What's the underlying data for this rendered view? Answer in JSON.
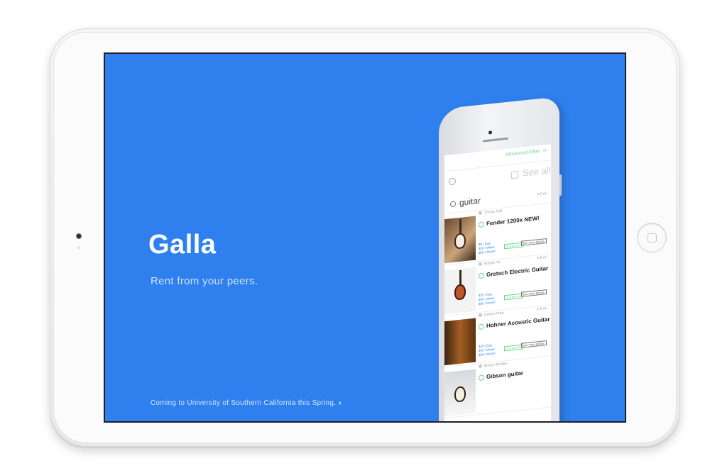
{
  "app": {
    "name": "Galla",
    "tagline": "Rent from your peers.",
    "coming_soon": "Coming to University of Southern California this Spring.",
    "coming_soon_chevron": "›"
  },
  "phone_app": {
    "advanced_filter": "Advanced Filter",
    "see_all": "See all",
    "search_query": "guitar",
    "search_distance": "0.2 mi",
    "listings": [
      {
        "owner": "Trevan Hall",
        "distance": "",
        "title": "Fender 1200x NEW!",
        "prices": [
          "$8 / Day",
          "$20 / Week",
          "$50 / Month"
        ],
        "rent_label": "rent by item",
        "more_label": "see more photos"
      },
      {
        "owner": "Bobbie Yu",
        "distance": "5.8 mi",
        "title": "Gretsch Electric Guitar",
        "prices": [
          "$25 / Day",
          "$40 / Week",
          "$90 / Month"
        ],
        "rent_label": "rent by item",
        "more_label": "see more photos"
      },
      {
        "owner": "Darius Feng",
        "distance": "5.8 mi",
        "title": "Hohner Acoustic Guitar",
        "prices": [
          "$25 / Day",
          "$40 / Week",
          "$58 / Month"
        ],
        "rent_label": "rent by item",
        "more_label": "see more photos"
      },
      {
        "owner": "Britton Bentley",
        "distance": "",
        "title": "Gibson guitar",
        "prices": [],
        "rent_label": "",
        "more_label": ""
      }
    ]
  },
  "colors": {
    "screen_background": "#2f80ee",
    "accent_green": "#6cd68a"
  }
}
